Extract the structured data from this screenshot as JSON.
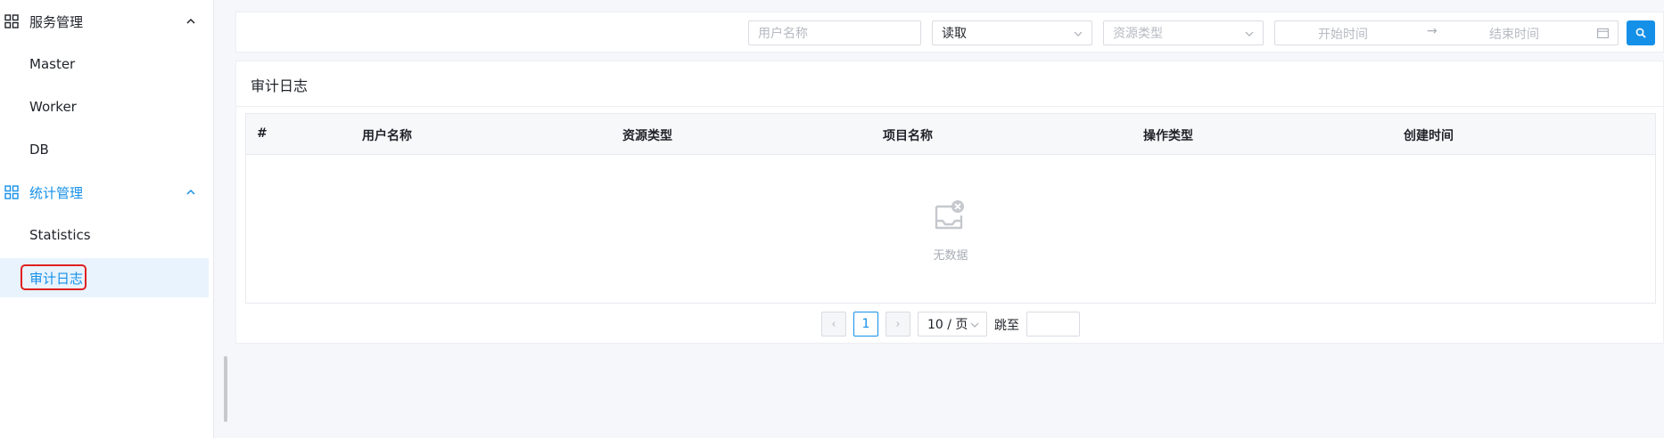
{
  "sidebar": {
    "groups": [
      {
        "label": "服务管理",
        "items": [
          "Master",
          "Worker",
          "DB"
        ]
      },
      {
        "label": "统计管理",
        "items": [
          "Statistics",
          "审计日志"
        ]
      }
    ],
    "active_item": "审计日志"
  },
  "search": {
    "user_placeholder": "用户名称",
    "operation_value": "读取",
    "resource_placeholder": "资源类型",
    "start_placeholder": "开始时间",
    "range_arrow": "→",
    "end_placeholder": "结束时间"
  },
  "card": {
    "title": "审计日志",
    "columns": [
      "#",
      "用户名称",
      "资源类型",
      "项目名称",
      "操作类型",
      "创建时间"
    ],
    "empty_text": "无数据"
  },
  "pagination": {
    "prev": "‹",
    "current_page": "1",
    "next": "›",
    "page_size": "10 / 页",
    "jump_label": "跳至"
  },
  "colors": {
    "accent": "#1590e8",
    "active_bg": "#e8f3fd",
    "highlight_ring": "#e02020"
  },
  "icons": {
    "group": "grid-icon",
    "chevron": "chevron-up-icon",
    "search": "search-icon",
    "calendar": "calendar-icon",
    "empty": "empty-inbox-icon"
  }
}
